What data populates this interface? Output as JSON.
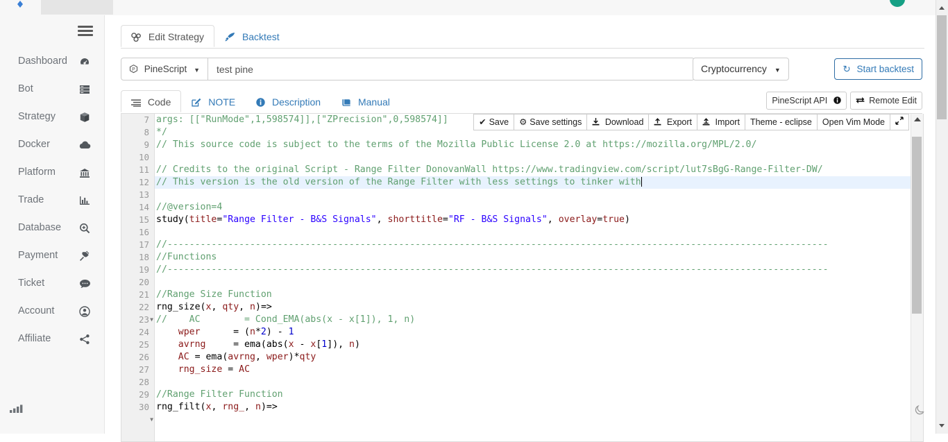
{
  "sidebar": {
    "toggle_icon": "hamburger-icon",
    "items": [
      {
        "label": "Dashboard",
        "icon": "dashboard-icon"
      },
      {
        "label": "Bot",
        "icon": "server-icon"
      },
      {
        "label": "Strategy",
        "icon": "cube-icon"
      },
      {
        "label": "Docker",
        "icon": "cloud-icon"
      },
      {
        "label": "Platform",
        "icon": "bank-icon"
      },
      {
        "label": "Trade",
        "icon": "chart-bar-icon"
      },
      {
        "label": "Database",
        "icon": "search-plus-icon"
      },
      {
        "label": "Payment",
        "icon": "plug-icon"
      },
      {
        "label": "Ticket",
        "icon": "comment-icon"
      },
      {
        "label": "Account",
        "icon": "user-circle-icon"
      },
      {
        "label": "Affiliate",
        "icon": "share-icon"
      }
    ],
    "footer_icon": "signal-icon"
  },
  "outer_tabs": [
    {
      "label": "Edit Strategy",
      "icon": "strategy-icon",
      "active": true
    },
    {
      "label": "Backtest",
      "icon": "rocket-icon",
      "active": false
    }
  ],
  "strategy_bar": {
    "language_label": "PineScript",
    "language_icon": "pinescript-icon",
    "name_value": "test pine",
    "name_placeholder": "",
    "category_label": "Cryptocurrency",
    "start_backtest_label": "Start backtest",
    "start_backtest_icon": "refresh-icon"
  },
  "inner_tabs": [
    {
      "label": "Code",
      "icon": "list-icon",
      "active": true
    },
    {
      "label": "NOTE",
      "icon": "edit-icon",
      "active": false
    },
    {
      "label": "Description",
      "icon": "info-icon",
      "active": false
    },
    {
      "label": "Manual",
      "icon": "book-icon",
      "active": false
    }
  ],
  "inner_right_buttons": [
    {
      "label": "PineScript API",
      "icon": "info-circle-icon"
    },
    {
      "label": "Remote Edit",
      "icon": "exchange-icon"
    }
  ],
  "editor_toolbar": [
    {
      "label": "Save",
      "icon": "check-icon"
    },
    {
      "label": "Save settings",
      "icon": "gear-icon"
    },
    {
      "label": "Download",
      "icon": "download-icon"
    },
    {
      "label": "Export",
      "icon": "export-icon"
    },
    {
      "label": "Import",
      "icon": "import-icon"
    },
    {
      "label": "Theme - eclipse",
      "icon": ""
    },
    {
      "label": "Open Vim Mode",
      "icon": ""
    },
    {
      "label": "",
      "icon": "expand-icon"
    }
  ],
  "editor": {
    "theme": "eclipse",
    "highlight_line": 12,
    "cursor_line": 12,
    "first_visible_line": 7,
    "lines": [
      {
        "n": 7,
        "fold": false,
        "clipped": true,
        "text": "args: [[\"RunMode\",1,598574]],[\"ZPrecision\",0,598574]]"
      },
      {
        "n": 8,
        "fold": false,
        "text": "*/"
      },
      {
        "n": 9,
        "fold": false,
        "text": "// This source code is subject to the terms of the Mozilla Public License 2.0 at https://mozilla.org/MPL/2.0/"
      },
      {
        "n": 10,
        "fold": false,
        "text": ""
      },
      {
        "n": 11,
        "fold": false,
        "text": "// Credits to the original Script - Range Filter DonovanWall https://www.tradingview.com/script/lut7sBgG-Range-Filter-DW/"
      },
      {
        "n": 12,
        "fold": false,
        "text": "// This version is the old version of the Range Filter with less settings to tinker with"
      },
      {
        "n": 13,
        "fold": false,
        "text": ""
      },
      {
        "n": 14,
        "fold": false,
        "text": "//@version=4"
      },
      {
        "n": 15,
        "fold": false,
        "text": "study(title=\"Range Filter - B&S Signals\", shorttitle=\"RF - B&S Signals\", overlay=true)"
      },
      {
        "n": 16,
        "fold": false,
        "text": ""
      },
      {
        "n": 17,
        "fold": false,
        "text": "//------------------------------------------------------------------------------------------------------------------------"
      },
      {
        "n": 18,
        "fold": false,
        "text": "//Functions"
      },
      {
        "n": 19,
        "fold": false,
        "text": "//------------------------------------------------------------------------------------------------------------------------"
      },
      {
        "n": 20,
        "fold": false,
        "text": ""
      },
      {
        "n": 21,
        "fold": false,
        "text": "//Range Size Function"
      },
      {
        "n": 22,
        "fold": false,
        "text": "rng_size(x, qty, n)=>"
      },
      {
        "n": 23,
        "fold": true,
        "text": "//    AC        = Cond_EMA(abs(x - x[1]), 1, n)"
      },
      {
        "n": 24,
        "fold": false,
        "text": "    wper      = (n*2) - 1"
      },
      {
        "n": 25,
        "fold": false,
        "text": "    avrng     = ema(abs(x - x[1]), n)"
      },
      {
        "n": 26,
        "fold": false,
        "text": "    AC = ema(avrng, wper)*qty"
      },
      {
        "n": 27,
        "fold": false,
        "text": "    rng_size = AC"
      },
      {
        "n": 28,
        "fold": false,
        "text": ""
      },
      {
        "n": 29,
        "fold": false,
        "text": "//Range Filter Function"
      },
      {
        "n": 30,
        "fold": true,
        "text": "rng_filt(x, rng_, n)=>"
      }
    ]
  },
  "dark_mode_icon": "moon-icon"
}
